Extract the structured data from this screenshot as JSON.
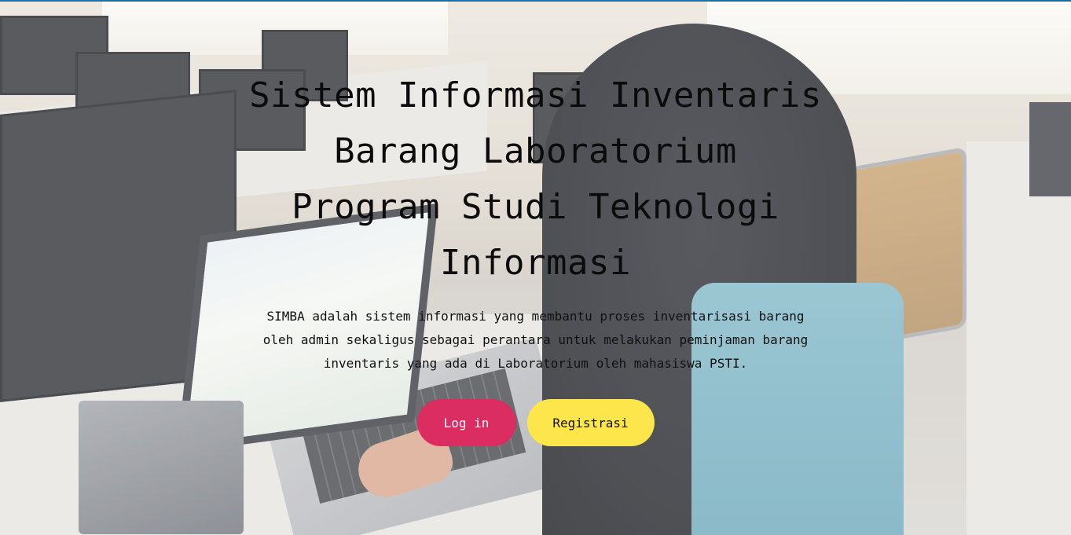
{
  "hero": {
    "title_lines": [
      "Sistem Informasi Inventaris",
      "Barang Laboratorium",
      "Program Studi Teknologi",
      "Informasi"
    ],
    "description_lines": [
      "SIMBA adalah sistem informasi yang membantu proses inventarisasi barang",
      "oleh admin sekaligus sebagai perantara untuk melakukan peminjaman barang",
      "inventaris yang ada di Laboratorium oleh mahasiswa PSTI."
    ]
  },
  "buttons": {
    "login_label": "Log in",
    "register_label": "Registrasi"
  },
  "colors": {
    "login_button": "#dc2d63",
    "register_button": "#fde64c",
    "top_strip": "#1d6fa5"
  }
}
